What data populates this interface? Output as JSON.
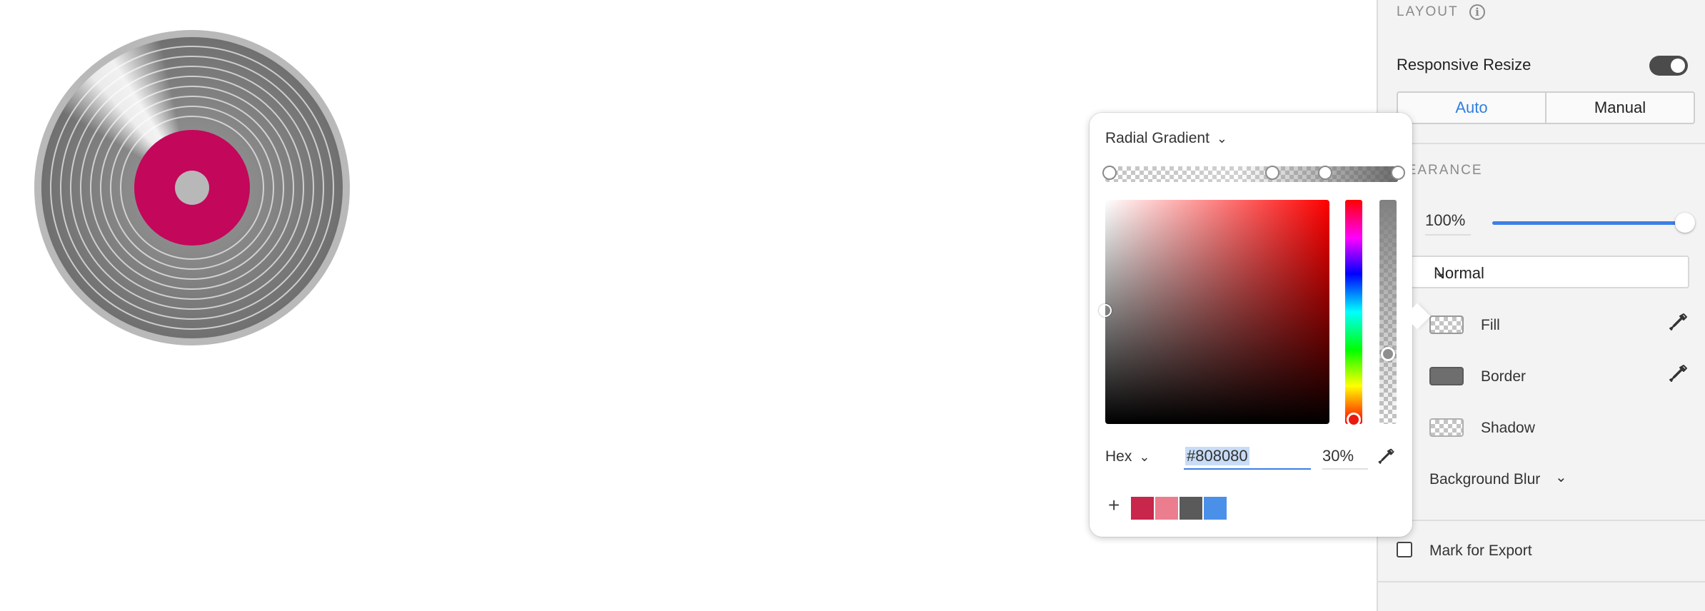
{
  "inspector": {
    "layout_title": "LAYOUT",
    "responsive_resize_label": "Responsive Resize",
    "resize_modes": [
      "Auto",
      "Manual"
    ],
    "active_resize_mode": "Auto",
    "appearance_title": "PEARANCE",
    "opacity_value": "100%",
    "opacity_level": 1.0,
    "blend_mode": "Normal",
    "properties": [
      {
        "label": "Fill"
      },
      {
        "label": "Border"
      },
      {
        "label": "Shadow"
      },
      {
        "label": "Background Blur"
      }
    ],
    "mark_for_export_label": "Mark for Export"
  },
  "picker": {
    "gradient_type": "Radial Gradient",
    "format": "Hex",
    "hex_value": "#808080",
    "alpha_value": "30%",
    "saved_colors": [
      "#c8264a",
      "#ec7d8f",
      "#5a5a5a",
      "#4a90e8"
    ]
  },
  "colors": {
    "accent": "#3d7fe4",
    "vinyl_label": "#c3075a"
  }
}
